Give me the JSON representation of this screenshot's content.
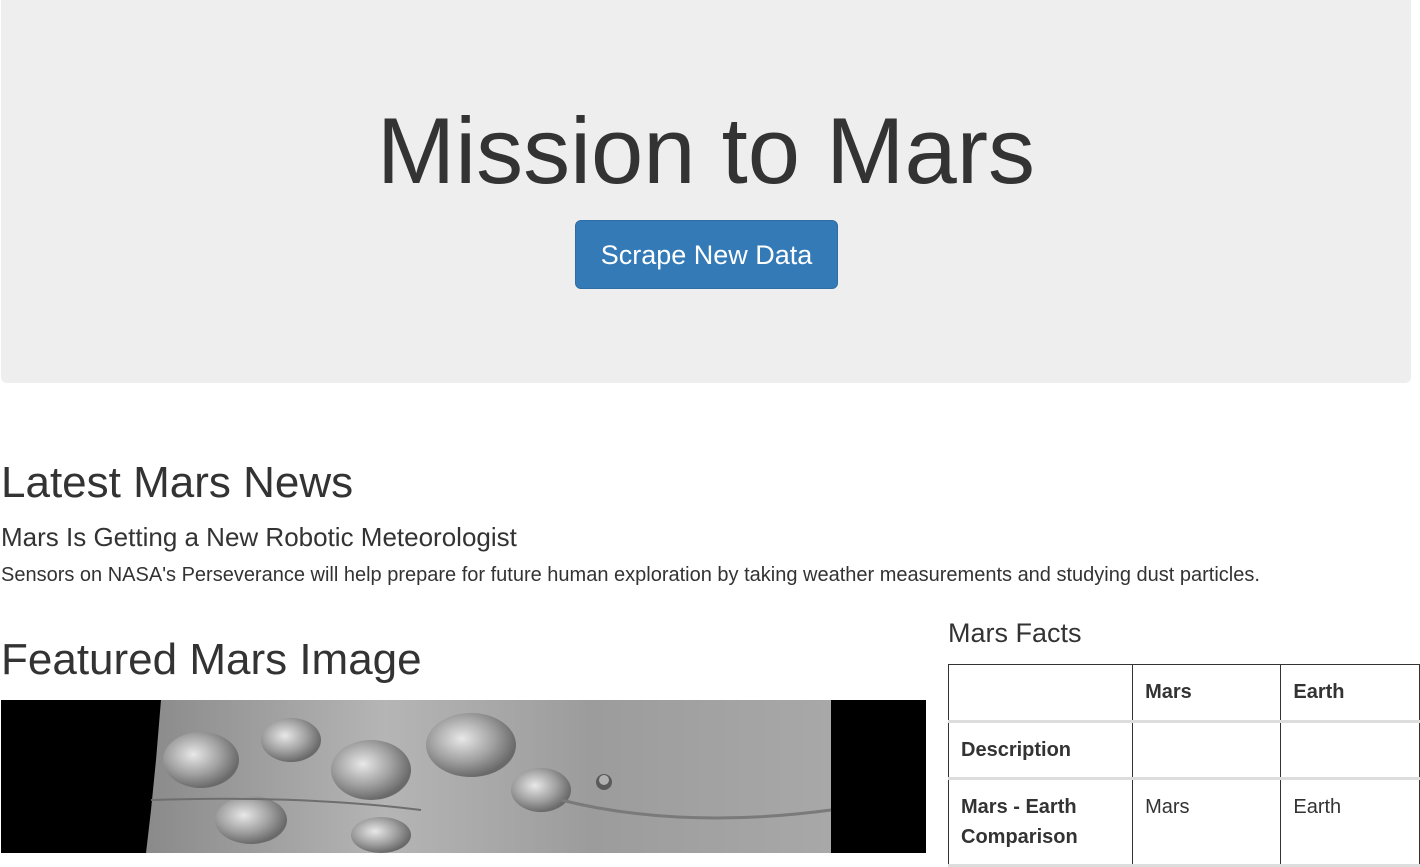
{
  "header": {
    "title": "Mission to Mars",
    "scrape_button": "Scrape New Data"
  },
  "news": {
    "section_title": "Latest Mars News",
    "headline": "Mars Is Getting a New Robotic Meteorologist",
    "teaser": "Sensors on NASA's Perseverance will help prepare for future human exploration by taking weather measurements and studying dust particles."
  },
  "featured": {
    "section_title": "Featured Mars Image"
  },
  "facts": {
    "section_title": "Mars Facts",
    "columns": [
      "",
      "Mars",
      "Earth"
    ],
    "rows": [
      {
        "label": "Description",
        "mars": "",
        "earth": ""
      },
      {
        "label": "Mars - Earth Comparison",
        "mars": "Mars",
        "earth": "Earth"
      }
    ]
  },
  "colors": {
    "jumbotron_bg": "#eeeeee",
    "button_bg": "#337ab7",
    "text": "#333333"
  }
}
